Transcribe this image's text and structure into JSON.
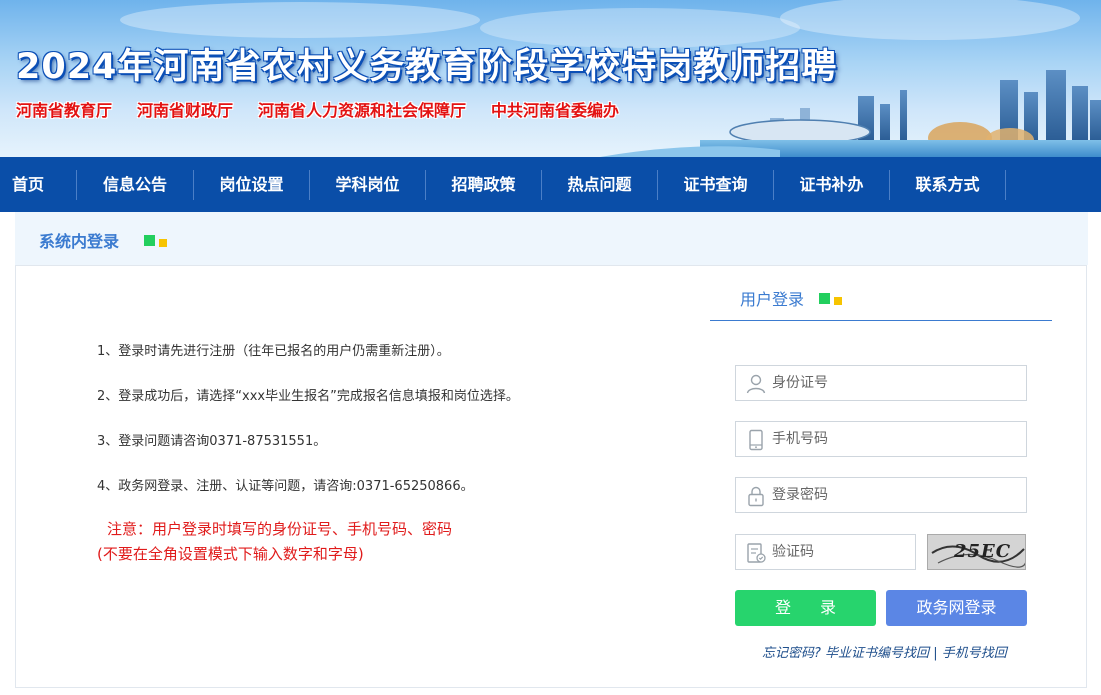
{
  "banner": {
    "title": "2024年河南省农村义务教育阶段学校特岗教师招聘",
    "orgs": [
      "河南省教育厅",
      "河南省财政厅",
      "河南省人力资源和社会保障厅",
      "中共河南省委编办"
    ]
  },
  "nav": {
    "items": [
      "首页",
      "信息公告",
      "岗位设置",
      "学科岗位",
      "招聘政策",
      "热点问题",
      "证书查询",
      "证书补办",
      "联系方式"
    ]
  },
  "section": {
    "title": "系统内登录"
  },
  "notes": {
    "items": [
      "1、登录时请先进行注册（往年已报名的用户仍需重新注册）。",
      "2、登录成功后，请选择“xxx毕业生报名”完成报名信息填报和岗位选择。",
      "3、登录问题请咨询0371-87531551。",
      "4、政务网登录、注册、认证等问题，请咨询:0371-65250866。"
    ],
    "warning_line1": "注意：用户登录时填写的身份证号、手机号码、密码",
    "warning_line2": "(不要在全角设置模式下输入数字和字母)"
  },
  "login": {
    "title": "用户登录",
    "id_placeholder": "身份证号",
    "phone_placeholder": "手机号码",
    "password_placeholder": "登录密码",
    "captcha_placeholder": "验证码",
    "captcha_text": "25EC",
    "login_button": "登 录",
    "gov_button": "政务网登录",
    "forgot_link": "忘记密码?",
    "cert_link": "毕业证书编号找回",
    "phone_link": "手机号找回",
    "separator": "|"
  },
  "colors": {
    "nav_bg": "#0a4ea8",
    "accent": "#3b7bd0",
    "login_btn": "#27d46d",
    "gov_btn": "#5b86e5",
    "warning": "#e01b1b"
  }
}
